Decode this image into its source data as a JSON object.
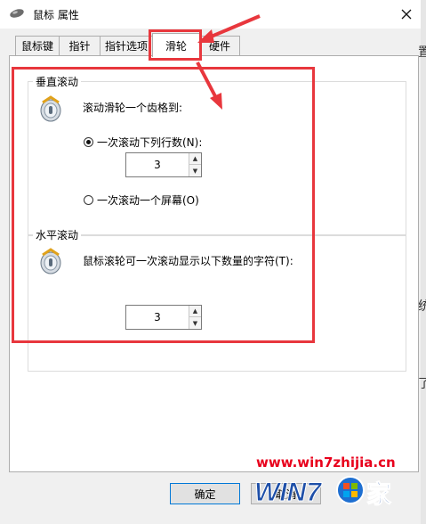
{
  "window": {
    "title": "鼠标 属性"
  },
  "tabs": [
    {
      "label": "鼠标键"
    },
    {
      "label": "指针"
    },
    {
      "label": "指针选项"
    },
    {
      "label": "滑轮",
      "active": true
    },
    {
      "label": "硬件"
    }
  ],
  "vertical_scroll": {
    "legend": "垂直滚动",
    "description": "滚动滑轮一个齿格到:",
    "option_lines": "一次滚动下列行数(N):",
    "option_lines_selected": true,
    "lines_value": "3",
    "option_screen": "一次滚动一个屏幕(O)",
    "option_screen_selected": false
  },
  "horizontal_scroll": {
    "legend": "水平滚动",
    "description": "鼠标滚轮可一次滚动显示以下数量的字符(T):",
    "chars_value": "3"
  },
  "buttons": {
    "ok": "确定",
    "cancel": "取消"
  },
  "watermark": {
    "url": "www.win7zhijia.cn",
    "logo_text": "WIN7之家"
  },
  "edge_fragments": [
    "置",
    "统",
    "了"
  ],
  "colors": {
    "annotation_red": "#e8373d",
    "button_accent": "#0078d7"
  }
}
